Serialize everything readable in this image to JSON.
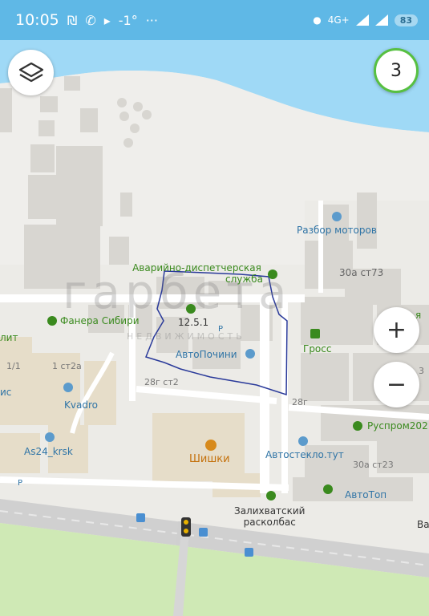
{
  "status_bar": {
    "time": "10:05",
    "temperature": "-1°",
    "more": "···",
    "network": "4G+",
    "battery": "83"
  },
  "map_controls": {
    "layers_icon": "layers-icon",
    "badge_count": "3",
    "zoom_in": "+",
    "zoom_out": "−"
  },
  "watermark": {
    "brand": "гарбета",
    "sub": "НЕДВИЖИМОСТЬ"
  },
  "places": {
    "emergency": "Аварийно-диспетчерская служба",
    "emergency_line1": "Аварийно-диспетчерская",
    "emergency_line2": "служба",
    "parts": "Разбор моторов",
    "plot": "12.5.1",
    "autofix": "АвтоПочини",
    "plywood": "Фанера Сибири",
    "gross": "Гросс",
    "rusprom": "Руспром202",
    "autoglass": "Автостекло.тут",
    "kvadro": "Kvadro",
    "as24": "As24_krsk",
    "shishki": "Шишки",
    "autotop": "АвтоТоп",
    "zalikh": "Залихватский расколбас",
    "zalikh_line1": "Залихватский",
    "zalikh_line2": "расколбас"
  },
  "addresses": {
    "a30st73": "30а ст73",
    "a28g_st2": "28г ст2",
    "a28g": "28г",
    "a30a_st23": "30а ст23",
    "a1st2a": "1 ст2а",
    "a1_1": "1/1",
    "cut_lit": "лит",
    "cut_is": "ис",
    "cut_ya": "я",
    "cut_3": "3",
    "cut_va": "Ва",
    "parking_p": "P"
  },
  "colors": {
    "water": "#9fd9f6",
    "status_bar": "#5fb8e6",
    "land": "#ecebe7",
    "buildings": "#d8d6d1",
    "road": "#d0d0d0",
    "green_area": "#cfe9b5",
    "plot_outline": "#2a3a9a"
  }
}
